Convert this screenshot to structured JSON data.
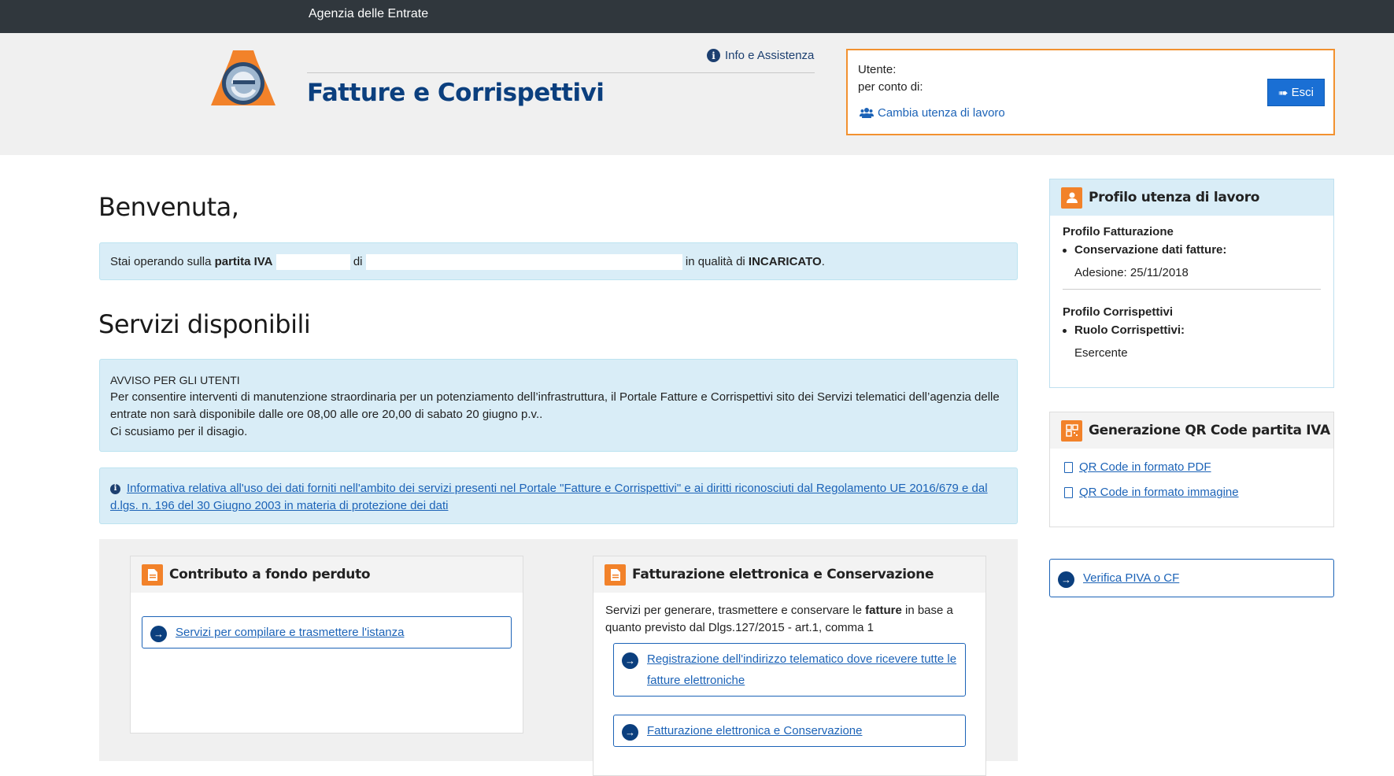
{
  "topbar": {
    "brand": "Agenzia delle Entrate"
  },
  "header": {
    "info_link": "Info e Assistenza",
    "app_title": "Fatture e Corrispettivi"
  },
  "user_box": {
    "utente_label": "Utente:",
    "per_conto_label": "per conto di:",
    "switch_link": "Cambia utenza di lavoro",
    "logout_button": "Esci"
  },
  "main": {
    "welcome": "Benvenuta,",
    "piva": {
      "prefix": "Stai operando sulla ",
      "partita_iva_label": "partita IVA",
      "di": " di ",
      "in_qualita": " in qualità di ",
      "role": "INCARICATO",
      "suffix": "."
    },
    "services_title": "Servizi disponibili",
    "avviso": {
      "title": "AVVISO PER GLI UTENTI",
      "line1": "Per consentire interventi di manutenzione straordinaria per un potenziamento dell’infrastruttura, il Portale Fatture e Corrispettivi sito dei Servizi telematici dell’agenzia delle entrate non sarà disponibile dalle ore 08,00 alle ore 20,00 di sabato 20 giugno p.v..",
      "line2": "Ci scusiamo per il disagio."
    },
    "informativa_link": "Informativa relativa all'uso dei dati forniti nell'ambito dei servizi presenti nel Portale \"Fatture e Corrispettivi\" e ai diritti riconosciuti dal Regolamento UE 2016/679 e dal d.lgs. n. 196 del 30 Giugno 2003 in materia di protezione dei dati",
    "cards": {
      "contributo": {
        "title": "Contributo a fondo perduto",
        "link": "Servizi per compilare e trasmettere l'istanza"
      },
      "fatturazione": {
        "title": "Fatturazione elettronica e Conservazione",
        "desc_pre": "Servizi per generare, trasmettere e conservare le ",
        "desc_bold": "fatture",
        "desc_post": " in base a quanto previsto dal Dlgs.127/2015 - art.1, comma 1",
        "link1": "Registrazione dell'indirizzo telematico dove ricevere tutte le fatture elettroniche",
        "link2": "Fatturazione elettronica e Conservazione"
      }
    }
  },
  "sidebar": {
    "profilo": {
      "title": "Profilo utenza di lavoro",
      "fatt_title": "Profilo Fatturazione",
      "fatt_item": "Conservazione dati fatture:",
      "fatt_value": "Adesione: 25/11/2018",
      "corr_title": "Profilo Corrispettivi",
      "corr_item": "Ruolo Corrispettivi:",
      "corr_value": "Esercente"
    },
    "qr": {
      "title": "Generazione QR Code partita IVA",
      "pdf_link": "QR Code in formato PDF",
      "img_link": "QR Code in formato immagine"
    },
    "verifica_link": "Verifica PIVA o CF"
  },
  "colors": {
    "accent_orange": "#f2822a",
    "brand_blue": "#0b3f7e",
    "link_blue": "#1c63b7",
    "info_bg": "#d9edf7"
  }
}
